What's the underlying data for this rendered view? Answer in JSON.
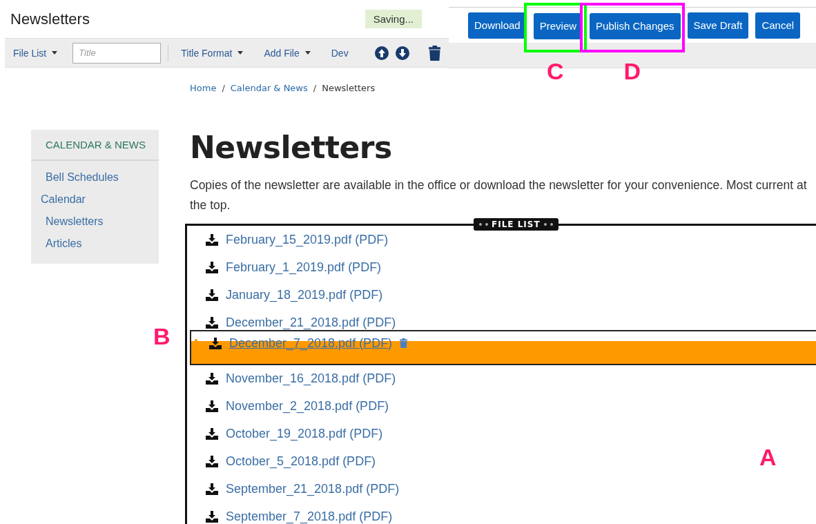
{
  "header": {
    "title": "Newsletters",
    "status": "Saving..."
  },
  "toolbar": {
    "file_list": "File List",
    "title_field": {
      "placeholder": "Title"
    },
    "menus": [
      {
        "label": "Title Format",
        "dropdown": true
      },
      {
        "label": "Add File",
        "dropdown": true
      },
      {
        "label": "Dev",
        "dropdown": false
      }
    ]
  },
  "actions": [
    {
      "label": "Download"
    },
    {
      "label": "Preview",
      "annotation": {
        "letter": "C",
        "color": "#00ff00"
      }
    },
    {
      "label": "Publish Changes",
      "annotation": {
        "letter": "D",
        "color": "#ff00ff"
      }
    },
    {
      "label": "Save Draft"
    },
    {
      "label": "Cancel"
    }
  ],
  "breadcrumb": {
    "items": [
      {
        "label": "Home",
        "current": false
      },
      {
        "label": "Calendar & News",
        "current": false
      },
      {
        "label": "Newsletters",
        "current": true
      }
    ],
    "separators": [
      "/",
      "/"
    ]
  },
  "sidebar": {
    "heading": "CALENDAR & NEWS",
    "items": [
      {
        "label": "Bell Schedules",
        "indented": true
      },
      {
        "label": "Calendar",
        "indented": false
      },
      {
        "label": "Newsletters",
        "indented": true
      },
      {
        "label": "Articles",
        "indented": true
      }
    ]
  },
  "page": {
    "heading": "Newsletters",
    "intro": "Copies of the newsletter are available in the office or download the newsletter for your convenience. Most current at the top."
  },
  "file_list": {
    "badge": "FILE LIST",
    "annotation": "A",
    "files": [
      {
        "kind": "file",
        "name": "February_15_2019.pdf",
        "type": "(PDF)"
      },
      {
        "kind": "file",
        "name": "February_1_2019.pdf",
        "type": "(PDF)"
      },
      {
        "kind": "file",
        "name": "January_18_2019.pdf",
        "type": "(PDF)"
      },
      {
        "kind": "file",
        "name": "December_21_2018.pdf",
        "type": "(PDF)"
      },
      {
        "kind": "dragging",
        "name": "December_7_2018.pdf",
        "type": "(PDF)",
        "annotation": "B"
      },
      {
        "kind": "file",
        "name": "November_16_2018.pdf",
        "type": "(PDF)"
      },
      {
        "kind": "file",
        "name": "November_2_2018.pdf",
        "type": "(PDF)"
      },
      {
        "kind": "file",
        "name": "October_19_2018.pdf",
        "type": "(PDF)"
      },
      {
        "kind": "file",
        "name": "October_5_2018.pdf",
        "type": "(PDF)"
      },
      {
        "kind": "file",
        "name": "September_21_2018.pdf",
        "type": "(PDF)"
      },
      {
        "kind": "file",
        "name": "September_7_2018.pdf",
        "type": "(PDF)"
      }
    ]
  }
}
